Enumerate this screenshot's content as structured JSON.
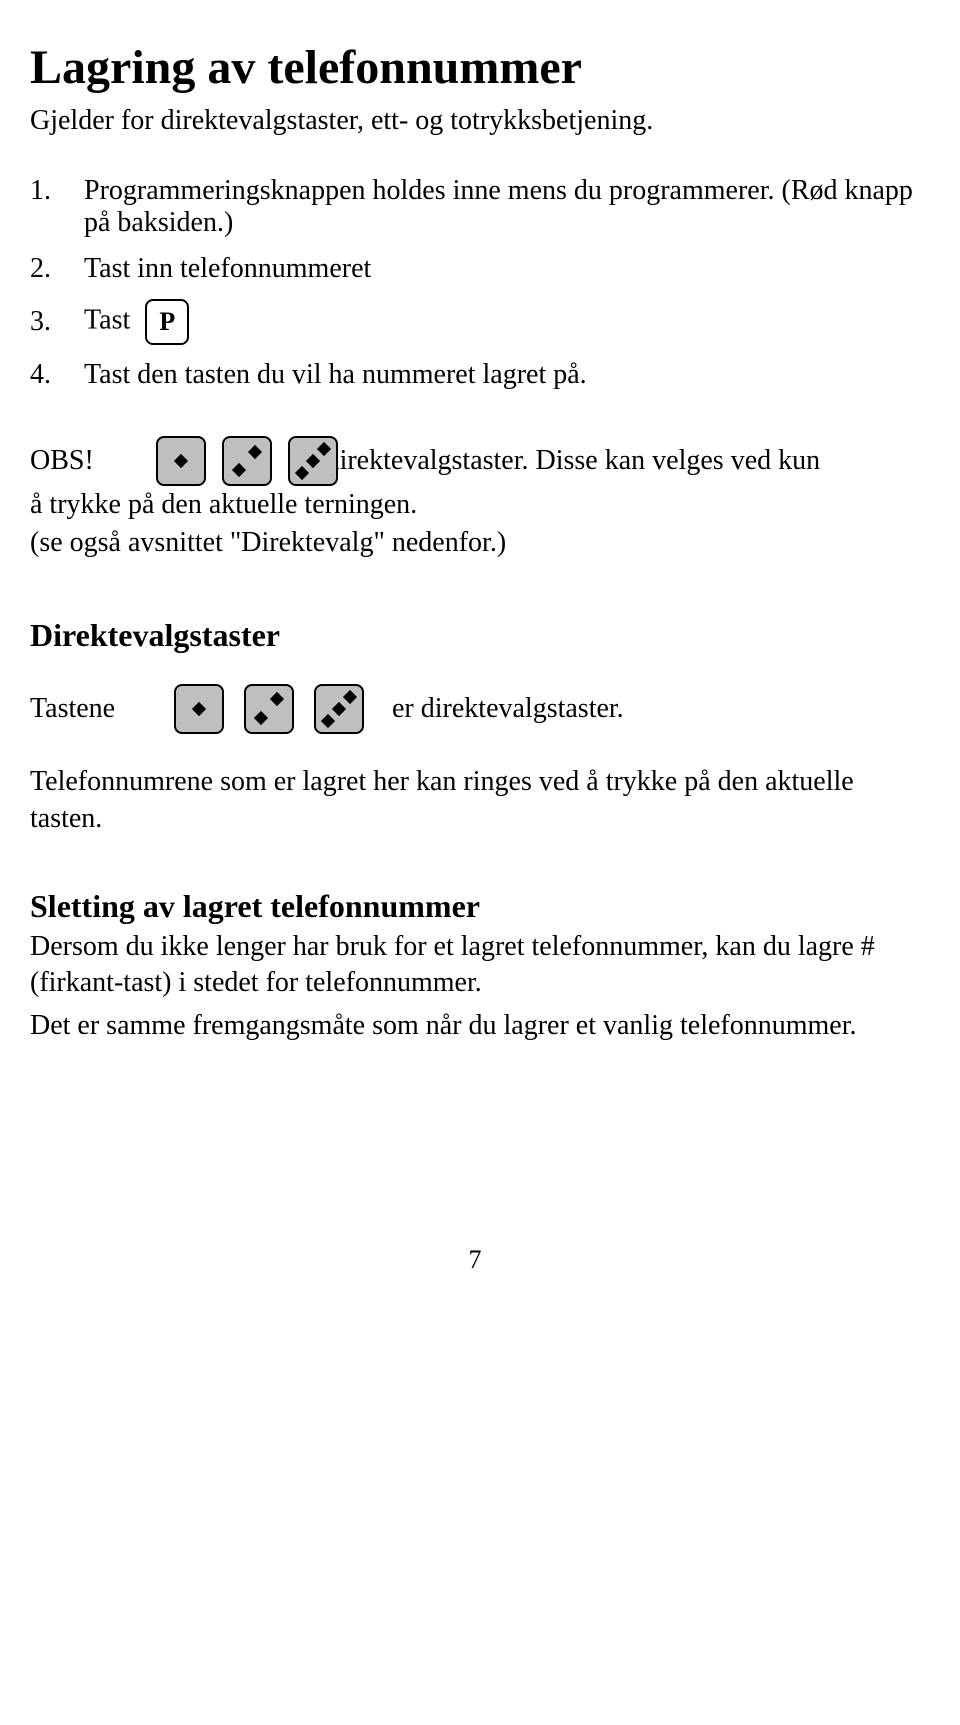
{
  "title": "Lagring av telefonnummer",
  "subtitle": "Gjelder for direktevalgstaster, ett- og totrykksbetjening.",
  "steps": [
    {
      "num": "1.",
      "text": "Programmeringsknappen holdes inne mens du programmerer. (Rød knapp på baksiden.)"
    },
    {
      "num": "2.",
      "text": "Tast inn telefonnummeret"
    },
    {
      "num": "3.",
      "text": "Tast"
    },
    {
      "num": "4.",
      "text": "Tast den tasten du vil ha nummeret lagret på."
    }
  ],
  "p_key_label": "P",
  "obs": {
    "label": "OBS!",
    "tail": "lirektevalgstaster. Disse kan velges ved kun",
    "line2": "å trykke på den aktuelle terningen.",
    "line3": "(se også avsnittet \"Direktevalg\" nedenfor.)"
  },
  "section2": {
    "heading": "Direktevalgstaster",
    "tastene_label": "Tastene",
    "tastene_tail": "er direktevalgstaster.",
    "body": "Telefonnumrene som er lagret her kan ringes ved å trykke på den aktuelle tasten."
  },
  "section3": {
    "heading": "Sletting av lagret telefonnummer",
    "p1": "Dersom du ikke lenger har bruk for et lagret telefonnummer, kan du lagre # (firkant-tast) i stedet for telefonnummer.",
    "p2": "Det er samme fremgangsmåte som når du lagrer et vanlig telefonnummer."
  },
  "page_number": "7"
}
